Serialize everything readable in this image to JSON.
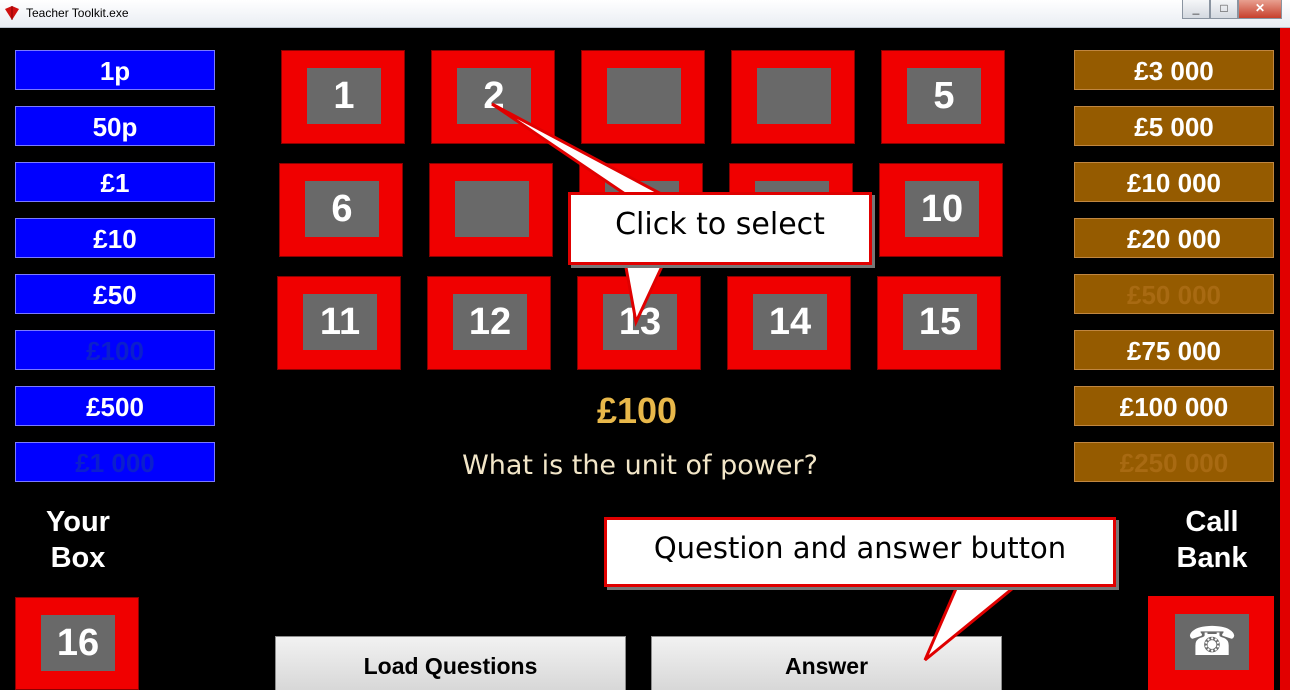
{
  "window": {
    "title": "Teacher Toolkit.exe",
    "minimize": "_",
    "maximize": "□",
    "close": "✕"
  },
  "left_values": [
    {
      "label": "1p",
      "used": false
    },
    {
      "label": "50p",
      "used": false
    },
    {
      "label": "£1",
      "used": false
    },
    {
      "label": "£10",
      "used": false
    },
    {
      "label": "£50",
      "used": false
    },
    {
      "label": "£100",
      "used": true
    },
    {
      "label": "£500",
      "used": false
    },
    {
      "label": "£1 000",
      "used": true
    }
  ],
  "right_values": [
    {
      "label": "£3 000",
      "used": false
    },
    {
      "label": "£5 000",
      "used": false
    },
    {
      "label": "£10 000",
      "used": false
    },
    {
      "label": "£20 000",
      "used": false
    },
    {
      "label": "£50 000",
      "used": true
    },
    {
      "label": "£75 000",
      "used": false
    },
    {
      "label": "£100 000",
      "used": false
    },
    {
      "label": "£250 000",
      "used": true
    }
  ],
  "boxes": [
    "1",
    "2",
    "",
    "",
    "5",
    "6",
    "",
    "",
    "",
    "10",
    "11",
    "12",
    "13",
    "14",
    "15"
  ],
  "prize": "£100",
  "question": "What is the unit of power?",
  "your_box": {
    "line1": "Your",
    "line2": "Box",
    "number": "16"
  },
  "call_bank": {
    "line1": "Call",
    "line2": "Bank",
    "icon": "☎"
  },
  "buttons": {
    "load": "Load Questions",
    "answer": "Answer"
  },
  "callouts": {
    "select": "Click to select",
    "qa": "Question and answer button"
  },
  "colors": {
    "accent_red": "#f00000",
    "low_value_blue": "#0000ff",
    "high_value_brown": "#955b00",
    "prize_gold": "#e8b84a"
  }
}
